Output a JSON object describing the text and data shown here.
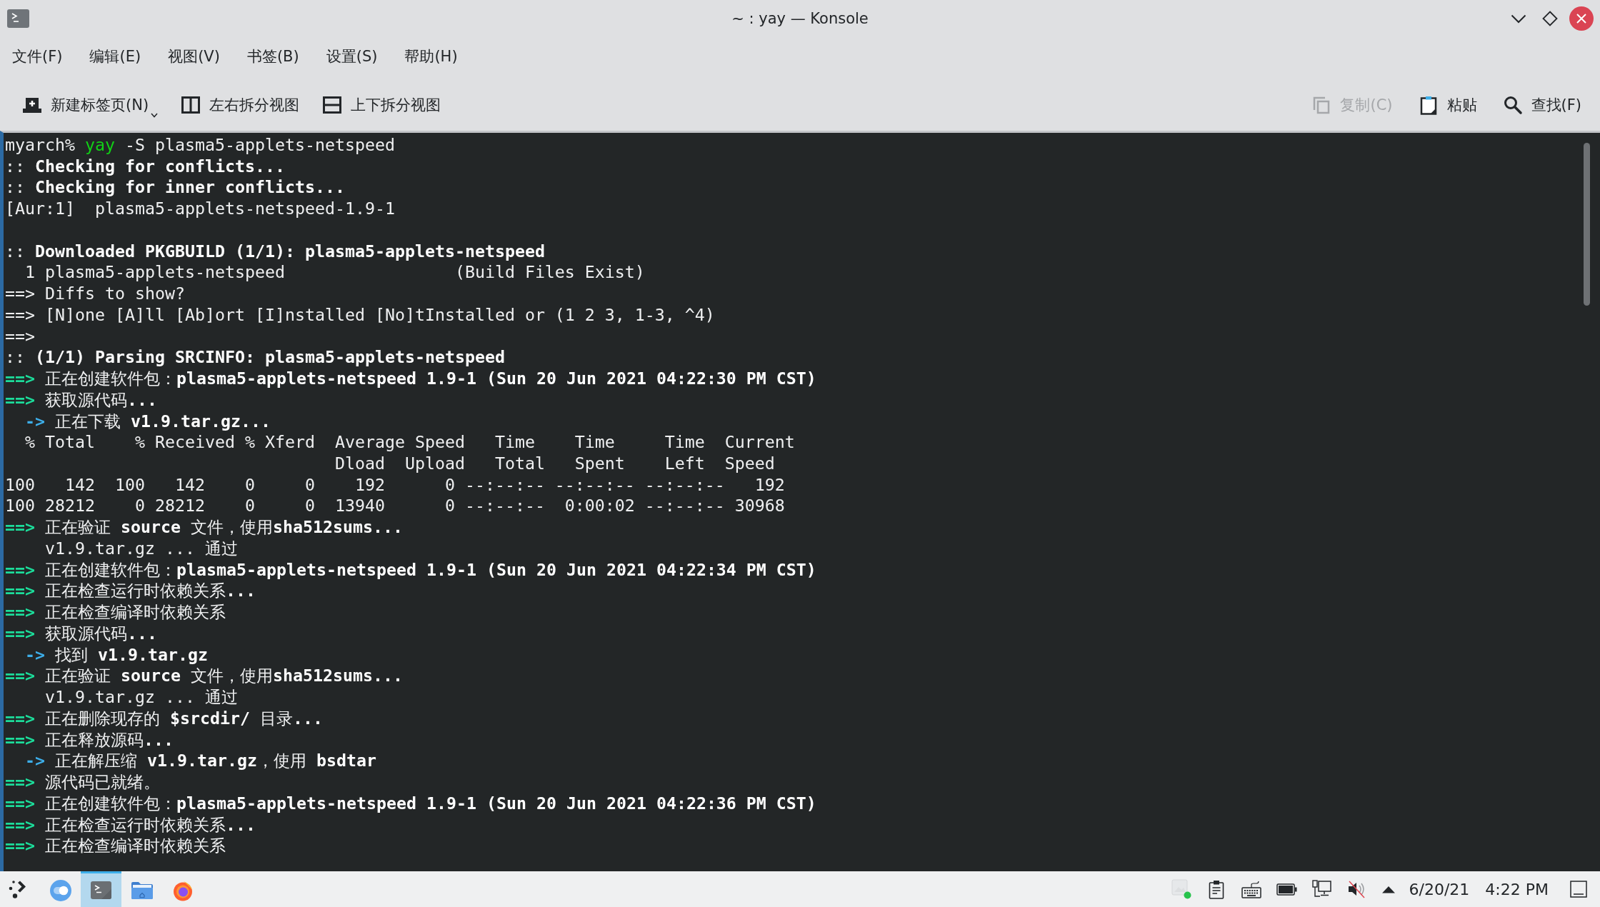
{
  "window": {
    "title": "~ : yay — Konsole"
  },
  "menu": [
    "文件(F)",
    "编辑(E)",
    "视图(V)",
    "书签(B)",
    "设置(S)",
    "帮助(H)"
  ],
  "toolbar": {
    "left": [
      {
        "label": "新建标签页(N)",
        "menu": true,
        "disabled": false
      },
      {
        "label": "左右拆分视图",
        "menu": false,
        "disabled": false
      },
      {
        "label": "上下拆分视图",
        "menu": false,
        "disabled": false
      }
    ],
    "right": [
      {
        "label": "复制(C)",
        "menu": false,
        "disabled": true
      },
      {
        "label": "粘贴",
        "menu": false,
        "disabled": false
      },
      {
        "label": "查找(F)",
        "menu": false,
        "disabled": false
      }
    ]
  },
  "terminal": {
    "lines": [
      {
        "kind": "text",
        "segments": [
          {
            "text": "myarch% "
          },
          {
            "text": "yay",
            "color": "#11d116"
          },
          {
            "text": " -S plasma5-applets-netspeed"
          }
        ]
      },
      {
        "kind": "text",
        "segments": [
          {
            "text": ":: **Checking for conflicts...**"
          }
        ]
      },
      {
        "kind": "text",
        "segments": [
          {
            "text": ":: **Checking for inner conflicts...**"
          }
        ]
      },
      {
        "kind": "text",
        "segments": [
          {
            "text": "[Aur:1]  plasma5-applets-netspeed-1.9-1"
          }
        ]
      },
      {
        "kind": "blank"
      },
      {
        "kind": "text",
        "segments": [
          {
            "text": ":: **Downloaded PKGBUILD (1/1): plasma5-applets-netspeed**"
          }
        ]
      },
      {
        "kind": "text",
        "segments": [
          {
            "text": "  1 plasma5-applets-netspeed                 (Build Files Exist)"
          }
        ]
      },
      {
        "kind": "text",
        "segments": [
          {
            "text": "==> Diffs to show?"
          }
        ]
      },
      {
        "kind": "text",
        "segments": [
          {
            "text": "==> [N]one [A]ll [Ab]ort [I]nstalled [No]tInstalled or (1 2 3, 1-3, ^4)"
          }
        ]
      },
      {
        "kind": "text",
        "segments": [
          {
            "text": "==>"
          }
        ]
      },
      {
        "kind": "text",
        "segments": [
          {
            "text": ":: **(1/1) Parsing SRCINFO: plasma5-applets-netspeed**"
          }
        ]
      },
      {
        "kind": "text",
        "segments": [
          {
            "text": "**==>**",
            "color": "#1cdc9a"
          },
          {
            "text": " 正在创建软件包：**plasma5-applets-netspeed 1.9-1 (Sun 20 Jun 2021 04:22:30 PM CST)**"
          }
        ]
      },
      {
        "kind": "text",
        "segments": [
          {
            "text": "**==>**",
            "color": "#1cdc9a"
          },
          {
            "text": " 获取源代码**...**"
          }
        ]
      },
      {
        "kind": "text",
        "segments": [
          {
            "text": "  **->**",
            "color": "#3daee9"
          },
          {
            "text": " 正在下载 **v1.9.tar.gz...**"
          }
        ]
      },
      {
        "kind": "text",
        "segments": [
          {
            "text": "  % Total    % Received % Xferd  Average Speed   Time    Time     Time  Current"
          }
        ]
      },
      {
        "kind": "text",
        "segments": [
          {
            "text": "                                 Dload  Upload   Total   Spent    Left  Speed"
          }
        ]
      },
      {
        "kind": "text",
        "segments": [
          {
            "text": "100   142  100   142    0     0    192      0 --:--:-- --:--:-- --:--:--   192"
          }
        ]
      },
      {
        "kind": "text",
        "segments": [
          {
            "text": "100 28212    0 28212    0     0  13940      0 --:--:--  0:00:02 --:--:-- 30968"
          }
        ]
      },
      {
        "kind": "text",
        "segments": [
          {
            "text": "**==>**",
            "color": "#1cdc9a"
          },
          {
            "text": " 正在验证 **source** 文件，使用**sha512sums...**"
          }
        ]
      },
      {
        "kind": "text",
        "segments": [
          {
            "text": "    v1.9.tar.gz ... 通过"
          }
        ]
      },
      {
        "kind": "text",
        "segments": [
          {
            "text": "**==>**",
            "color": "#1cdc9a"
          },
          {
            "text": " 正在创建软件包：**plasma5-applets-netspeed 1.9-1 (Sun 20 Jun 2021 04:22:34 PM CST)**"
          }
        ]
      },
      {
        "kind": "text",
        "segments": [
          {
            "text": "**==>**",
            "color": "#1cdc9a"
          },
          {
            "text": " 正在检查运行时依赖关系**...**"
          }
        ]
      },
      {
        "kind": "text",
        "segments": [
          {
            "text": "**==>**",
            "color": "#1cdc9a"
          },
          {
            "text": " 正在检查编译时依赖关系"
          }
        ]
      },
      {
        "kind": "text",
        "segments": [
          {
            "text": "**==>**",
            "color": "#1cdc9a"
          },
          {
            "text": " 获取源代码**...**"
          }
        ]
      },
      {
        "kind": "text",
        "segments": [
          {
            "text": "  **->**",
            "color": "#3daee9"
          },
          {
            "text": " 找到 **v1.9.tar.gz**"
          }
        ]
      },
      {
        "kind": "text",
        "segments": [
          {
            "text": "**==>**",
            "color": "#1cdc9a"
          },
          {
            "text": " 正在验证 **source** 文件，使用**sha512sums...**"
          }
        ]
      },
      {
        "kind": "text",
        "segments": [
          {
            "text": "    v1.9.tar.gz ... 通过"
          }
        ]
      },
      {
        "kind": "text",
        "segments": [
          {
            "text": "**==>**",
            "color": "#1cdc9a"
          },
          {
            "text": " 正在删除现存的 **$srcdir/** 目录**...**"
          }
        ]
      },
      {
        "kind": "text",
        "segments": [
          {
            "text": "**==>**",
            "color": "#1cdc9a"
          },
          {
            "text": " 正在释放源码**...**"
          }
        ]
      },
      {
        "kind": "text",
        "segments": [
          {
            "text": "  **->**",
            "color": "#3daee9"
          },
          {
            "text": " 正在解压缩 **v1.9.tar.gz**，使用 **bsdtar**"
          }
        ]
      },
      {
        "kind": "text",
        "segments": [
          {
            "text": "**==>**",
            "color": "#1cdc9a"
          },
          {
            "text": " 源代码已就绪。"
          }
        ]
      },
      {
        "kind": "text",
        "segments": [
          {
            "text": "**==>**",
            "color": "#1cdc9a"
          },
          {
            "text": " 正在创建软件包：**plasma5-applets-netspeed 1.9-1 (Sun 20 Jun 2021 04:22:36 PM CST)**"
          }
        ]
      },
      {
        "kind": "text",
        "segments": [
          {
            "text": "**==>**",
            "color": "#1cdc9a"
          },
          {
            "text": " 正在检查运行时依赖关系**...**"
          }
        ]
      },
      {
        "kind": "text",
        "segments": [
          {
            "text": "**==>**",
            "color": "#1cdc9a"
          },
          {
            "text": " 正在检查编译时依赖关系"
          }
        ]
      }
    ]
  },
  "taskbar": {
    "tasks": [
      {
        "selected": false
      },
      {
        "selected": true
      },
      {
        "selected": false
      },
      {
        "selected": false
      }
    ],
    "tray": {
      "sound_muted": true
    },
    "date": "6/20/21",
    "time": "4:22 PM"
  }
}
